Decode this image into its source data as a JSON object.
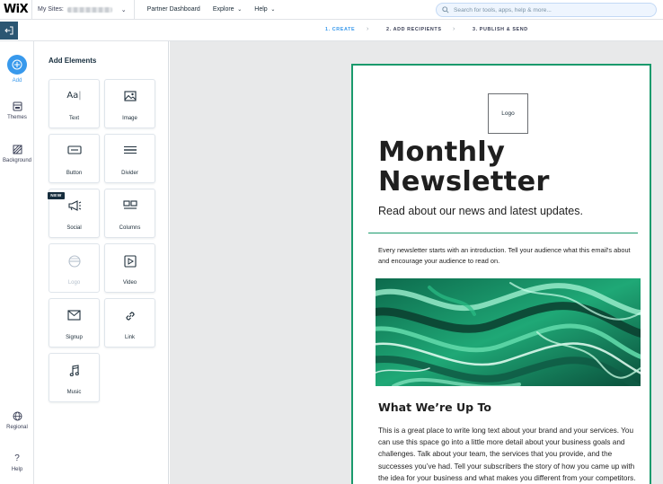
{
  "topbar": {
    "logo": "WiX",
    "my_sites_label": "My Sites:",
    "nav": [
      {
        "label": "Partner Dashboard",
        "has_menu": false
      },
      {
        "label": "Explore",
        "has_menu": true
      },
      {
        "label": "Help",
        "has_menu": true
      }
    ],
    "search_placeholder": "Search for tools, apps, help & more..."
  },
  "steps": [
    {
      "label": "1. CREATE",
      "active": true
    },
    {
      "label": "2. ADD RECIPIENTS",
      "active": false
    },
    {
      "label": "3. PUBLISH & SEND",
      "active": false
    }
  ],
  "rail": {
    "add": "Add",
    "themes": "Themes",
    "background": "Background",
    "regional": "Regional",
    "help": "Help"
  },
  "panel": {
    "title": "Add Elements",
    "new_badge": "NEW",
    "tiles": [
      {
        "label": "Text",
        "icon": "text-icon"
      },
      {
        "label": "Image",
        "icon": "image-icon"
      },
      {
        "label": "Button",
        "icon": "button-icon"
      },
      {
        "label": "Divider",
        "icon": "divider-icon"
      },
      {
        "label": "Social",
        "icon": "megaphone-icon"
      },
      {
        "label": "Columns",
        "icon": "columns-icon"
      },
      {
        "label": "Logo",
        "icon": "logo-icon"
      },
      {
        "label": "Video",
        "icon": "video-icon"
      },
      {
        "label": "Signup",
        "icon": "envelope-icon"
      },
      {
        "label": "Link",
        "icon": "link-icon"
      },
      {
        "label": "Music",
        "icon": "music-icon"
      }
    ]
  },
  "email": {
    "logo_placeholder": "Logo",
    "title": "Monthly Newsletter",
    "subtitle": "Read about our news and latest updates.",
    "intro": "Every newsletter starts with an introduction. Tell your audience what this email's about and encourage your audience to read on.",
    "section_heading": "What We’re Up To",
    "body": "This is a great place to write long text about your brand and your services. You can use this space go into a little more detail about your business goals and challenges. Talk about your team, the services that you provide, and the successes you’ve had. Tell your subscribers the story of how you came up with the idea for your business and what makes you different from your competitors. Make your story stand out and show your audience who you are."
  },
  "colors": {
    "accent_blue": "#3899ec",
    "email_border_green": "#1a9a6c",
    "back_button": "#2b5672",
    "canvas_bg": "#e8e9ea"
  }
}
